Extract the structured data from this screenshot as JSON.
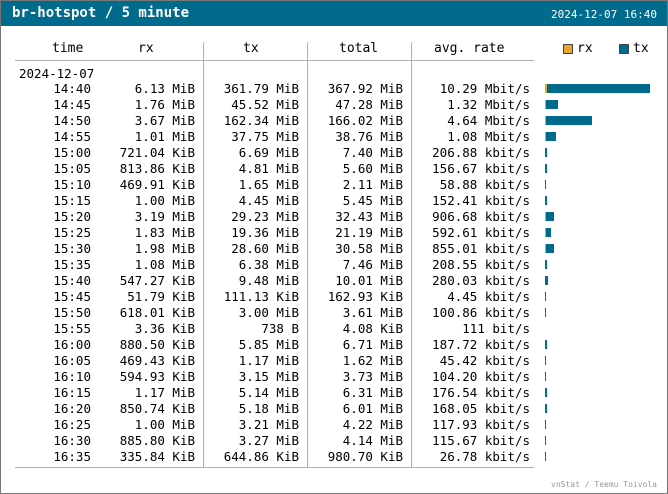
{
  "window": {
    "title": "br-hotspot / 5 minute",
    "timestamp": "2024-12-07 16:40"
  },
  "columns": {
    "time": "time",
    "rx": "rx",
    "tx": "tx",
    "total": "total",
    "rate": "avg. rate"
  },
  "legend": {
    "rx_label": "rx",
    "tx_label": "tx",
    "rx_color": "#e8a32a",
    "tx_color": "#006b8c"
  },
  "date": "2024-12-07",
  "rows": [
    {
      "time": "14:40",
      "rx": "6.13 MiB",
      "tx": "361.79 MiB",
      "total": "367.92 MiB",
      "rate": "10.29 Mbit/s",
      "rx_mib": 6.13,
      "tx_mib": 361.79
    },
    {
      "time": "14:45",
      "rx": "1.76 MiB",
      "tx": "45.52 MiB",
      "total": "47.28 MiB",
      "rate": "1.32 Mbit/s",
      "rx_mib": 1.76,
      "tx_mib": 45.52
    },
    {
      "time": "14:50",
      "rx": "3.67 MiB",
      "tx": "162.34 MiB",
      "total": "166.02 MiB",
      "rate": "4.64 Mbit/s",
      "rx_mib": 3.67,
      "tx_mib": 162.34
    },
    {
      "time": "14:55",
      "rx": "1.01 MiB",
      "tx": "37.75 MiB",
      "total": "38.76 MiB",
      "rate": "1.08 Mbit/s",
      "rx_mib": 1.01,
      "tx_mib": 37.75
    },
    {
      "time": "15:00",
      "rx": "721.04 KiB",
      "tx": "6.69 MiB",
      "total": "7.40 MiB",
      "rate": "206.88 kbit/s",
      "rx_mib": 0.704,
      "tx_mib": 6.69
    },
    {
      "time": "15:05",
      "rx": "813.86 KiB",
      "tx": "4.81 MiB",
      "total": "5.60 MiB",
      "rate": "156.67 kbit/s",
      "rx_mib": 0.795,
      "tx_mib": 4.81
    },
    {
      "time": "15:10",
      "rx": "469.91 KiB",
      "tx": "1.65 MiB",
      "total": "2.11 MiB",
      "rate": "58.88 kbit/s",
      "rx_mib": 0.459,
      "tx_mib": 1.65
    },
    {
      "time": "15:15",
      "rx": "1.00 MiB",
      "tx": "4.45 MiB",
      "total": "5.45 MiB",
      "rate": "152.41 kbit/s",
      "rx_mib": 1.0,
      "tx_mib": 4.45
    },
    {
      "time": "15:20",
      "rx": "3.19 MiB",
      "tx": "29.23 MiB",
      "total": "32.43 MiB",
      "rate": "906.68 kbit/s",
      "rx_mib": 3.19,
      "tx_mib": 29.23
    },
    {
      "time": "15:25",
      "rx": "1.83 MiB",
      "tx": "19.36 MiB",
      "total": "21.19 MiB",
      "rate": "592.61 kbit/s",
      "rx_mib": 1.83,
      "tx_mib": 19.36
    },
    {
      "time": "15:30",
      "rx": "1.98 MiB",
      "tx": "28.60 MiB",
      "total": "30.58 MiB",
      "rate": "855.01 kbit/s",
      "rx_mib": 1.98,
      "tx_mib": 28.6
    },
    {
      "time": "15:35",
      "rx": "1.08 MiB",
      "tx": "6.38 MiB",
      "total": "7.46 MiB",
      "rate": "208.55 kbit/s",
      "rx_mib": 1.08,
      "tx_mib": 6.38
    },
    {
      "time": "15:40",
      "rx": "547.27 KiB",
      "tx": "9.48 MiB",
      "total": "10.01 MiB",
      "rate": "280.03 kbit/s",
      "rx_mib": 0.534,
      "tx_mib": 9.48
    },
    {
      "time": "15:45",
      "rx": "51.79 KiB",
      "tx": "111.13 KiB",
      "total": "162.93 KiB",
      "rate": "4.45 kbit/s",
      "rx_mib": 0.0506,
      "tx_mib": 0.1085
    },
    {
      "time": "15:50",
      "rx": "618.01 KiB",
      "tx": "3.00 MiB",
      "total": "3.61 MiB",
      "rate": "100.86 kbit/s",
      "rx_mib": 0.6035,
      "tx_mib": 3.0
    },
    {
      "time": "15:55",
      "rx": "3.36 KiB",
      "tx": "738 B",
      "total": "4.08 KiB",
      "rate": "111 bit/s",
      "rx_mib": 0.0033,
      "tx_mib": 0.0007
    },
    {
      "time": "16:00",
      "rx": "880.50 KiB",
      "tx": "5.85 MiB",
      "total": "6.71 MiB",
      "rate": "187.72 kbit/s",
      "rx_mib": 0.86,
      "tx_mib": 5.85
    },
    {
      "time": "16:05",
      "rx": "469.43 KiB",
      "tx": "1.17 MiB",
      "total": "1.62 MiB",
      "rate": "45.42 kbit/s",
      "rx_mib": 0.458,
      "tx_mib": 1.17
    },
    {
      "time": "16:10",
      "rx": "594.93 KiB",
      "tx": "3.15 MiB",
      "total": "3.73 MiB",
      "rate": "104.20 kbit/s",
      "rx_mib": 0.581,
      "tx_mib": 3.15
    },
    {
      "time": "16:15",
      "rx": "1.17 MiB",
      "tx": "5.14 MiB",
      "total": "6.31 MiB",
      "rate": "176.54 kbit/s",
      "rx_mib": 1.17,
      "tx_mib": 5.14
    },
    {
      "time": "16:20",
      "rx": "850.74 KiB",
      "tx": "5.18 MiB",
      "total": "6.01 MiB",
      "rate": "168.05 kbit/s",
      "rx_mib": 0.831,
      "tx_mib": 5.18
    },
    {
      "time": "16:25",
      "rx": "1.00 MiB",
      "tx": "3.21 MiB",
      "total": "4.22 MiB",
      "rate": "117.93 kbit/s",
      "rx_mib": 1.0,
      "tx_mib": 3.21
    },
    {
      "time": "16:30",
      "rx": "885.80 KiB",
      "tx": "3.27 MiB",
      "total": "4.14 MiB",
      "rate": "115.67 kbit/s",
      "rx_mib": 0.865,
      "tx_mib": 3.27
    },
    {
      "time": "16:35",
      "rx": "335.84 KiB",
      "tx": "644.86 KiB",
      "total": "980.70 KiB",
      "rate": "26.78 kbit/s",
      "rx_mib": 0.328,
      "tx_mib": 0.63
    }
  ],
  "footer": "vnStat / Teemu Toivola"
}
